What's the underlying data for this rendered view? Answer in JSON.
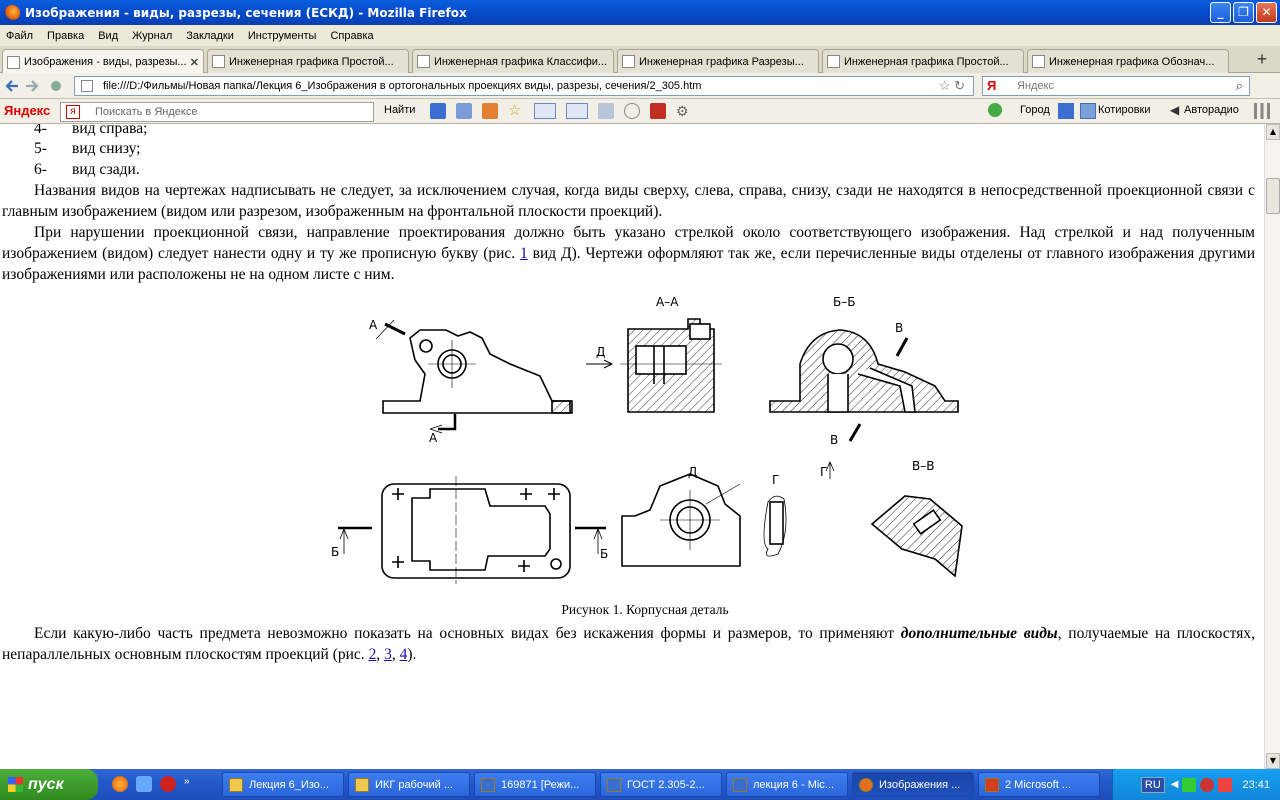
{
  "window": {
    "title": "Изображения - виды, разрезы, сечения (ЕСКД) - Mozilla Firefox"
  },
  "menu": [
    "Файл",
    "Правка",
    "Вид",
    "Журнал",
    "Закладки",
    "Инструменты",
    "Справка"
  ],
  "tabs": [
    {
      "label": "Изображения - виды, разрезы...",
      "active": true
    },
    {
      "label": "Инженерная графика Простой...",
      "active": false
    },
    {
      "label": "Инженерная графика Классифи...",
      "active": false
    },
    {
      "label": "Инженерная графика Разрезы...",
      "active": false
    },
    {
      "label": "Инженерная графика Простой...",
      "active": false
    },
    {
      "label": "Инженерная графика Обознач...",
      "active": false
    }
  ],
  "nav": {
    "url": "file:///D:/Фильмы/Новая папка/Лекция 6_Изображения в ортогональных проекциях виды, разрезы, сечения/2_305.htm",
    "search_placeholder": "Яндекс"
  },
  "yandex_bar": {
    "logo": "Яндекс",
    "search_placeholder": "Поискать в Яндексе",
    "find": "Найти",
    "city": "Город",
    "quotes": "Котировки",
    "radio": "Авторадио"
  },
  "content": {
    "list": [
      {
        "num": "4-",
        "text": "вид справа;"
      },
      {
        "num": "5-",
        "text": "вид снизу;"
      },
      {
        "num": "6-",
        "text": "вид сзади."
      }
    ],
    "para1": "Названия видов на чертежах надписывать не следует, за исключением случая, когда виды сверху, слева, справа, снизу, сзади не находятся в непосредственной проекционной связи с главным изображением (видом или разрезом, изображенным на фронтальной плоскости проекций).",
    "para2_a": "При нарушении проекционной связи, направление проектирования должно быть указано стрелкой около соответствующего изображения. Над стрелкой и над полученным изображением (видом) следует нанести одну и ту же прописную букву (рис. ",
    "para2_link": "1",
    "para2_b": " вид Д). Чертежи оформляют так же, если перечисленные виды отделены от главного изображения другими изображениями или расположены не на одном листе с ним.",
    "figure_labels": {
      "aa": "А–А",
      "bb": "Б–Б",
      "vv": "В–В",
      "a": "А",
      "b": "Б",
      "v": "В",
      "g": "Г",
      "d": "Д"
    },
    "caption": "Рисунок 1. Корпусная деталь",
    "para3_a": "Если какую-либо часть предмета невозможно показать на основных видах без искажения формы и размеров, то применяют ",
    "para3_em": "дополнительные виды",
    "para3_b": ", получаемые на плоскостях, непараллельных основным плоскостям проекций (рис. ",
    "para3_links": [
      "2",
      "3",
      "4"
    ],
    "para3_c": ")."
  },
  "taskbar": {
    "start": "пуск",
    "items": [
      {
        "label": "Лекция 6_Изо...",
        "active": false
      },
      {
        "label": "ИКГ рабочий ...",
        "active": false
      },
      {
        "label": "169871 [Режи...",
        "active": false
      },
      {
        "label": "ГОСТ 2.305-2...",
        "active": false
      },
      {
        "label": "лекция 6 - Mic...",
        "active": false
      },
      {
        "label": "Изображения ...",
        "active": true
      },
      {
        "label": "2 Microsoft ...",
        "active": false
      }
    ],
    "lang": "RU",
    "clock": "23:41"
  }
}
